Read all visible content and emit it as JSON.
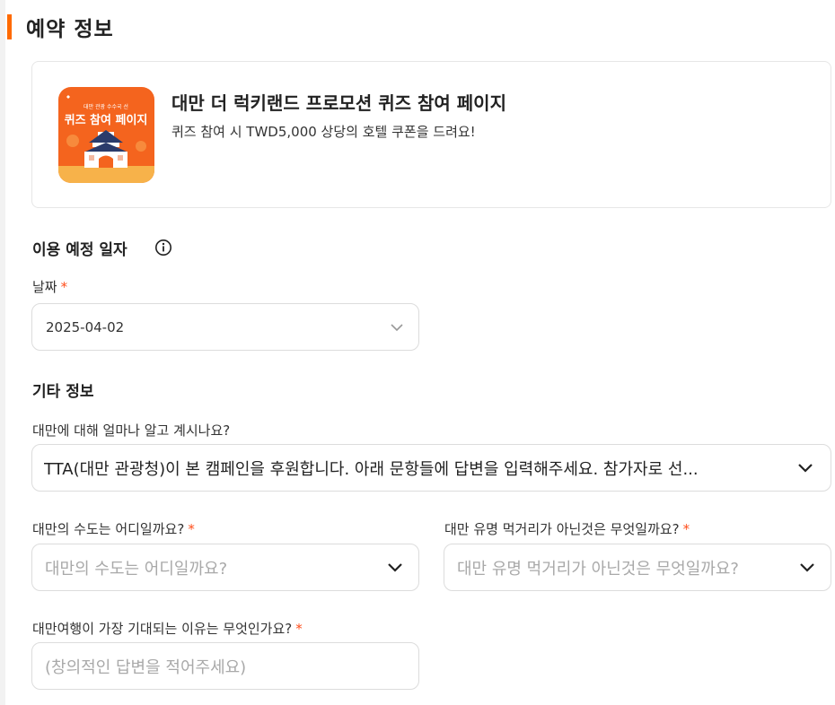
{
  "section": {
    "title": "예약 정보"
  },
  "promo": {
    "thumb": {
      "small_text": "대만 관광 수수국 선",
      "big_text": "퀴즈 참여 페이지"
    },
    "title": "대만 더 럭키랜드 프로모션 퀴즈 참여 페이지",
    "description": "퀴즈 참여 시 TWD5,000 상당의 호텔 쿠폰을 드려요!"
  },
  "schedule": {
    "heading": "이용 예정 일자",
    "info_icon": "info-circle-icon",
    "date_label": "날짜",
    "required_mark": "*",
    "date_value": "2025-04-02"
  },
  "other": {
    "heading": "기타 정보",
    "q1": {
      "label": "대만에 대해 얼마나 알고 계시나요?",
      "value": "TTA(대만 관광청)이 본 캠페인을 후원합니다. 아래 문항들에 답변을 입력해주세요. 참가자로 선..."
    },
    "q2": {
      "label": "대만의 수도는 어디일까요?",
      "placeholder": "대만의 수도는 어디일까요?"
    },
    "q3": {
      "label": "대만 유명 먹거리가 아닌것은 무엇일까요?",
      "placeholder": "대만 유명 먹거리가 아닌것은 무엇일까요?"
    },
    "q4": {
      "label": "대만여행이 가장 기대되는 이유는 무엇인가요?",
      "placeholder": "(창의적인 답변을 적어주세요)"
    },
    "required_mark": "*"
  },
  "colors": {
    "accent": "#ff6a00",
    "required": "#ff4d1a",
    "border": "#dcdcdc",
    "placeholder": "#a9a9a9"
  }
}
